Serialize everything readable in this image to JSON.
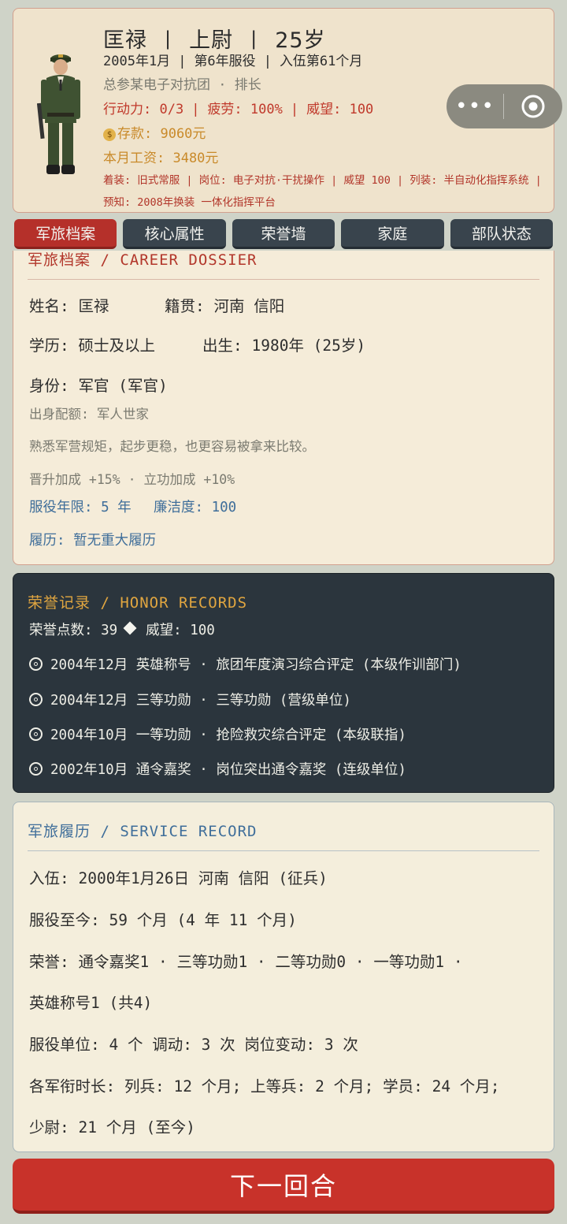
{
  "profile": {
    "name": "匡禄",
    "rank": "上尉",
    "age": "25岁",
    "sep": "|",
    "date": "2005年1月",
    "service_year": "第6年服役",
    "enlist_month": "入伍第61个月",
    "unit": "总参某电子对抗团 · 排长",
    "action": "行动力: 0/3",
    "fatigue": "疲劳: 100%",
    "prestige": "威望: 100",
    "savings": "存款: 9060元",
    "salary": "本月工资: 3480元",
    "equipment": "着装: 旧式常服 | 岗位: 电子对抗·干扰操作 | 威望 100 | 列装: 半自动化指挥系统 | 预知: 2008年换装 一体化指挥平台"
  },
  "capsule": {
    "more_icon": "more-dots-icon",
    "close_icon": "target-circle-icon",
    "dots": "•••"
  },
  "tabs": [
    {
      "label": "军旅档案",
      "active": true
    },
    {
      "label": "核心属性",
      "active": false
    },
    {
      "label": "荣誉墙",
      "active": false
    },
    {
      "label": "家庭",
      "active": false
    },
    {
      "label": "部队状态",
      "active": false
    }
  ],
  "dossier": {
    "title": "军旅档案 / CAREER DOSSIER",
    "name": "姓名: 匡禄",
    "hometown": "籍贯: 河南 信阳",
    "education": "学历: 硕士及以上",
    "birth": "出生: 1980年 (25岁)",
    "identity": "身份: 军官 (军官)",
    "origin": "出身配额: 军人世家",
    "origin_desc": "熟悉军营规矩，起步更稳，也更容易被拿来比较。",
    "bonus": "晋升加成 +15% · 立功加成 +10%",
    "term": "服役年限: 5 年",
    "integrity": "廉洁度: 100",
    "history": "履历: 暂无重大履历"
  },
  "honors": {
    "title": "荣誉记录 / HONOR RECORDS",
    "points": "荣誉点数: 39",
    "prestige": "威望: 100",
    "items": [
      "2004年12月 英雄称号 · 旅团年度演习综合评定 (本级作训部门)",
      "2004年12月 三等功勋 · 三等功勋 (营级单位)",
      "2004年10月 一等功勋 · 抢险救灾综合评定 (本级联指)",
      "2002年10月 通令嘉奖 · 岗位突出通令嘉奖 (连级单位)"
    ]
  },
  "service": {
    "title": "军旅履历 / SERVICE RECORD",
    "enlist": "入伍: 2000年1月26日  河南 信阳   (征兵)",
    "duration": "服役至今: 59 个月 (4 年 11 个月)",
    "honors_line1": "荣誉: 通令嘉奖1 · 三等功勋1 · 二等功勋0 · 一等功勋1 ·",
    "honors_line2": "英雄称号1 (共4)",
    "units": "服役单位: 4 个  调动: 3 次  岗位变动: 3 次",
    "rank_time1": "各军衔时长: 列兵: 12 个月; 上等兵: 2 个月; 学员: 24 个月;",
    "rank_time2": "少尉: 21 个月 (至今)"
  },
  "next_button": "下一回合",
  "colors": {
    "accent": "#c8322a",
    "dark_card": "#2b353d",
    "paper": "#f5ecd9"
  }
}
